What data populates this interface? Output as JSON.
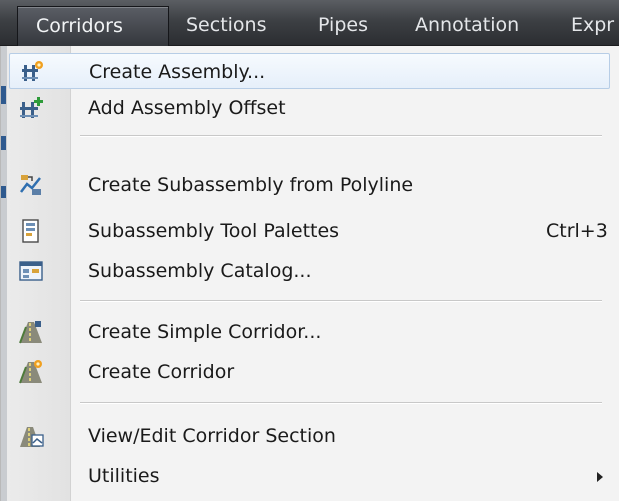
{
  "menubar": {
    "items": [
      {
        "label": "Corridors",
        "active": true
      },
      {
        "label": "Sections"
      },
      {
        "label": "Pipes"
      },
      {
        "label": "Annotation"
      },
      {
        "label": "Expr"
      }
    ]
  },
  "menu": {
    "items": [
      {
        "label": "Create Assembly...",
        "icon": "create-assembly-icon",
        "highlighted": true
      },
      {
        "label": "Add Assembly Offset",
        "icon": "add-assembly-offset-icon"
      },
      {
        "label": "Create Subassembly from Polyline",
        "icon": "create-subassembly-icon"
      },
      {
        "label": "Subassembly Tool Palettes",
        "icon": "tool-palettes-icon",
        "shortcut": "Ctrl+3"
      },
      {
        "label": "Subassembly Catalog...",
        "icon": "catalog-icon"
      },
      {
        "label": "Create Simple Corridor...",
        "icon": "simple-corridor-icon"
      },
      {
        "label": "Create Corridor",
        "icon": "corridor-icon"
      },
      {
        "label": "View/Edit Corridor Section",
        "icon": "corridor-section-icon"
      },
      {
        "label": "Utilities",
        "has_submenu": true
      }
    ]
  }
}
